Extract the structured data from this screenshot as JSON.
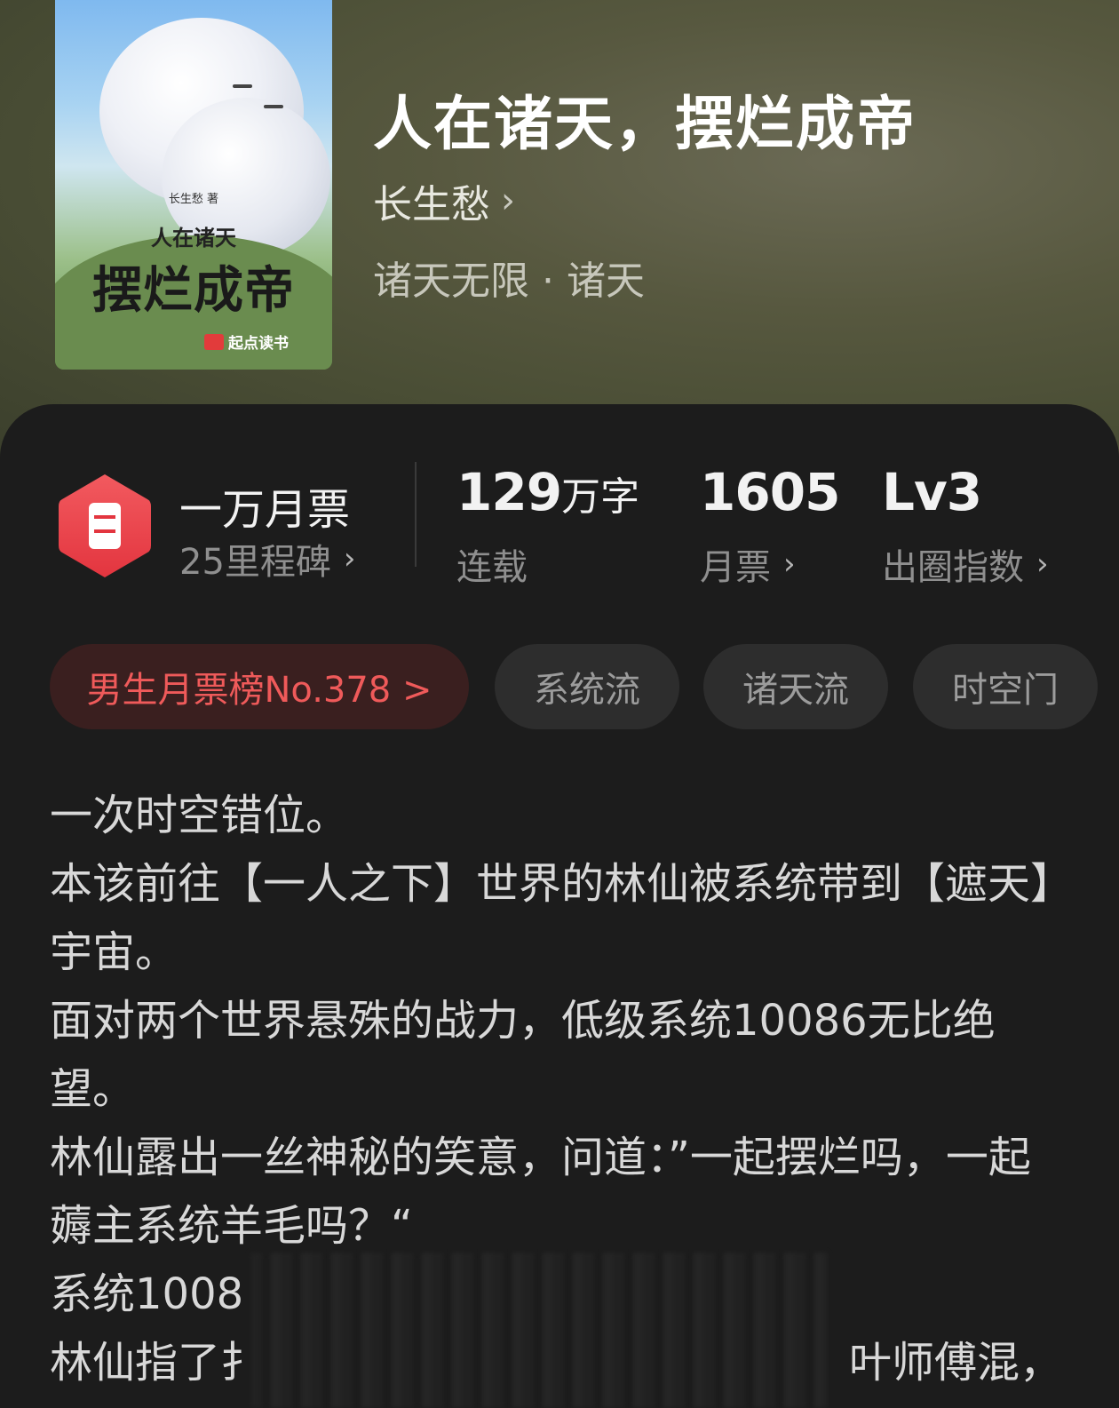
{
  "cover": {
    "author_small": "长生愁 著",
    "subtitle": "人在诸天",
    "title": "摆烂成帝",
    "publisher": "起点读书"
  },
  "book": {
    "title": "人在诸天，摆烂成帝",
    "author": "长生愁",
    "genre": "诸天无限 · 诸天"
  },
  "stats": {
    "milestone_title": "一万月票",
    "milestone_sub": "25里程碑",
    "words_num": "129",
    "words_unit": "万字",
    "words_label": "连载",
    "tickets_num": "1605",
    "tickets_label": "月票",
    "level_num": "Lv3",
    "level_label": "出圈指数"
  },
  "tags": {
    "rank": "男生月票榜No.378 >",
    "t1": "系统流",
    "t2": "诸天流",
    "t3": "时空门"
  },
  "description": {
    "line1": "一次时空错位。",
    "line2": "本该前往【一人之下】世界的林仙被系统带到【遮天】宇宙。",
    "line3": "面对两个世界悬殊的战力，低级系统10086无比绝望。",
    "line4": "林仙露出一丝神秘的笑意，问道：”一起摆烂吗，一起薅主系统羊毛吗？“",
    "line5": "系统1008",
    "line6a": "林仙指了扌",
    "line6b": "叶师傅混，"
  },
  "colors": {
    "accent_red": "#ef5a5a",
    "hex_red": "#e8414a",
    "background": "#1c1c1c",
    "hero_olive": "#57583f"
  }
}
